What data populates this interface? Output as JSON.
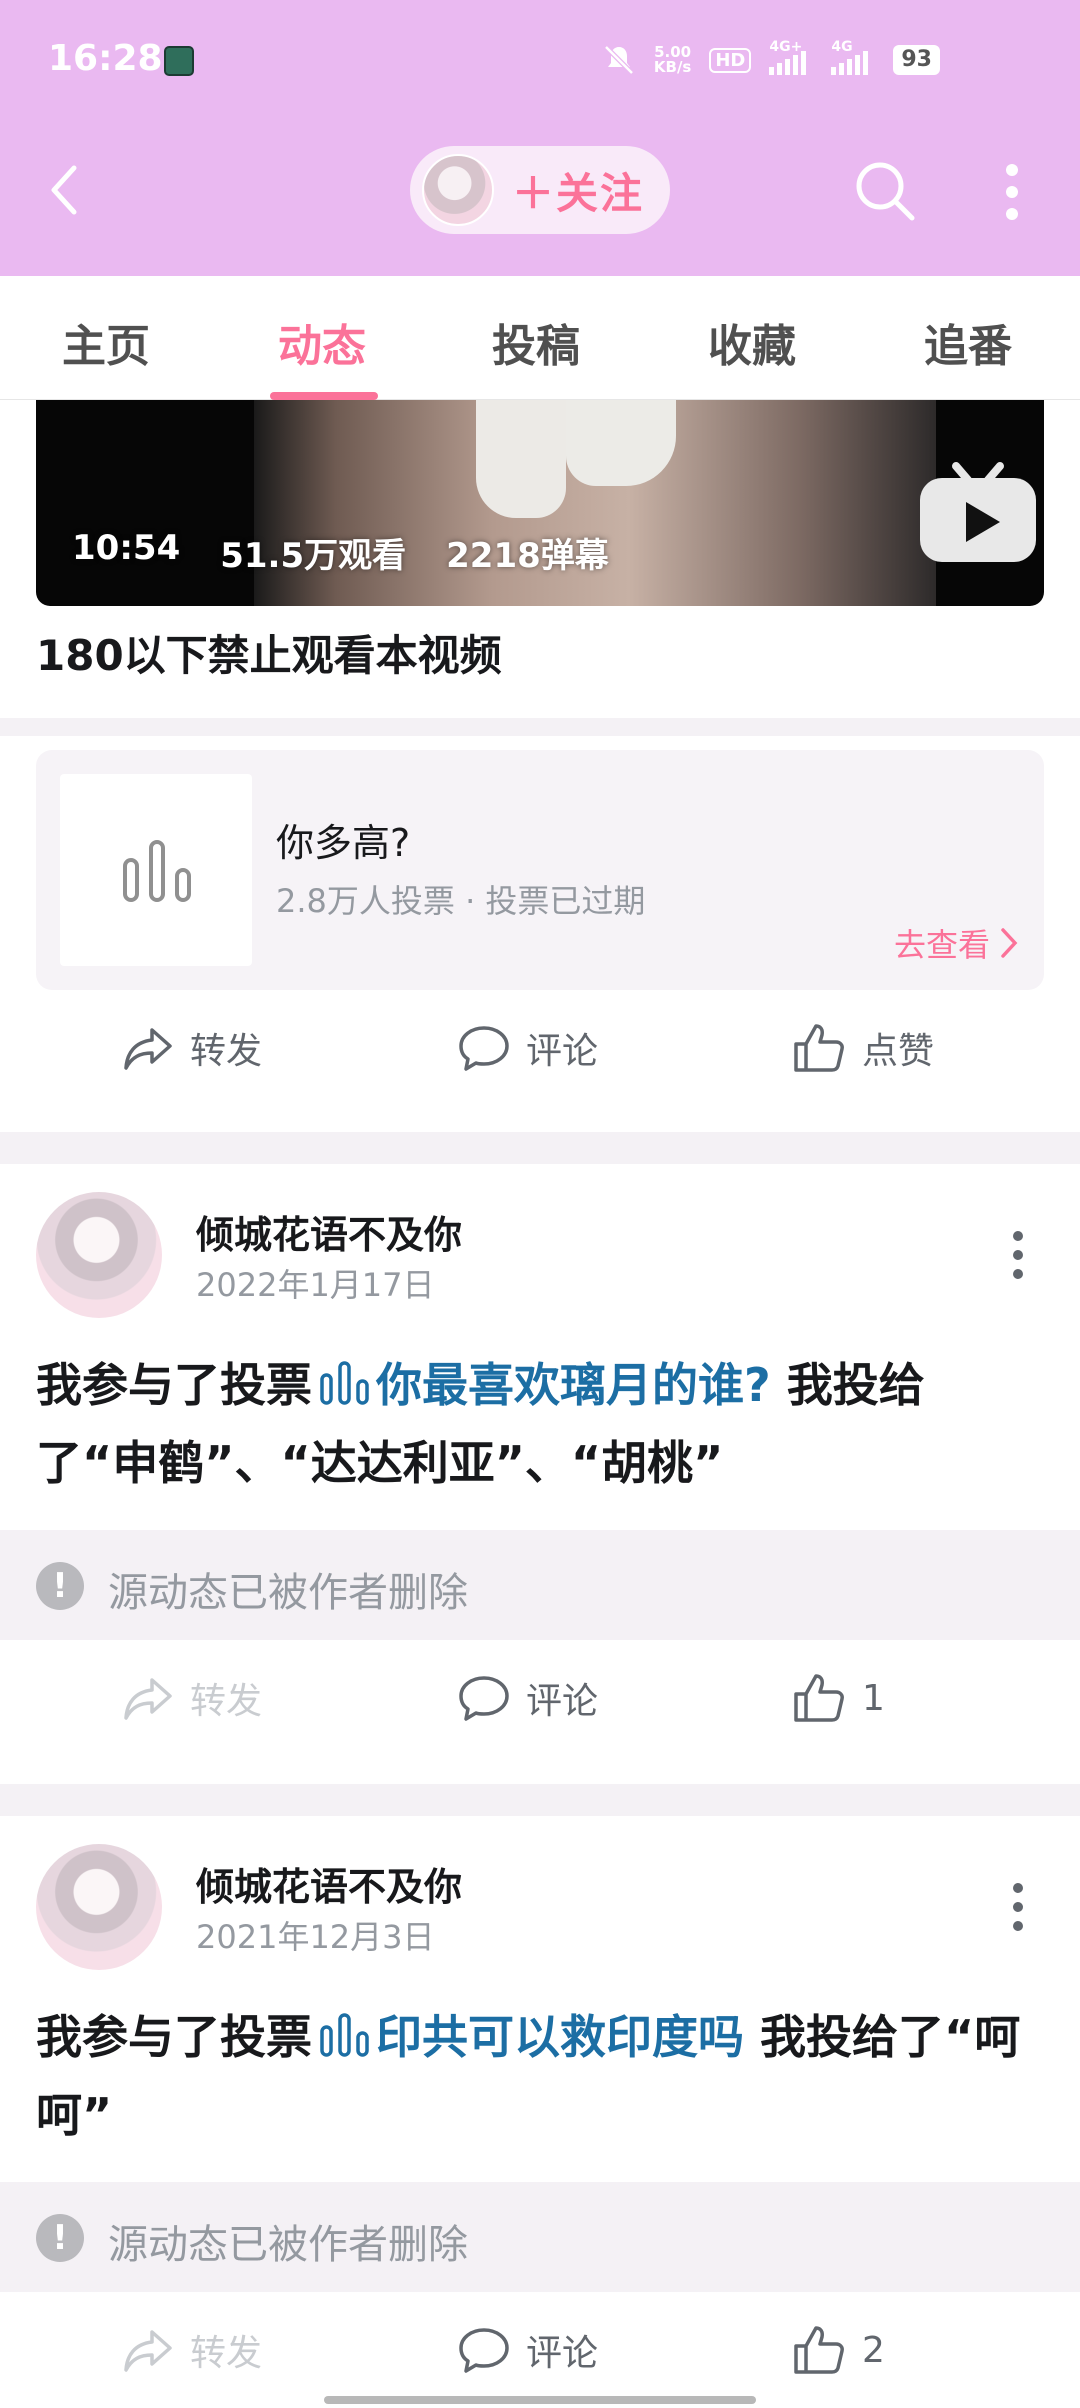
{
  "status_bar": {
    "time": "16:28",
    "speed": "5.00",
    "speed_unit": "KB/s",
    "hd_label": "HD",
    "net1": "4G+",
    "net2": "4G",
    "battery": "93"
  },
  "header": {
    "follow_label": "＋关注",
    "icons": [
      "back-icon",
      "search-icon",
      "more-icon"
    ]
  },
  "tabs": [
    {
      "label": "主页"
    },
    {
      "label": "动态",
      "active": true
    },
    {
      "label": "投稿"
    },
    {
      "label": "收藏"
    },
    {
      "label": "追番"
    }
  ],
  "card1": {
    "video": {
      "duration": "10:54",
      "views": "51.5万观看",
      "danmaku": "2218弹幕",
      "title": "180以下禁止观看本视频"
    },
    "poll": {
      "title": "你多高?",
      "meta": "2.8万人投票 · 投票已过期",
      "link": "去查看"
    },
    "actions": {
      "repost": "转发",
      "comment": "评论",
      "like": "点赞"
    }
  },
  "posts": [
    {
      "author": "倾城花语不及你",
      "date": "2022年1月17日",
      "text_prefix": "我参与了投票",
      "vote_link": "你最喜欢璃月的谁?",
      "text_suffix": " 我投给了“申鹤”、“达达利亚”、“胡桃”",
      "deleted_msg": "源动态已被作者删除",
      "repost": "转发",
      "comment": "评论",
      "likes": "1"
    },
    {
      "author": "倾城花语不及你",
      "date": "2021年12月3日",
      "text_prefix": "我参与了投票",
      "vote_link": "印共可以救印度吗",
      "text_suffix": " 我投给了“呵呵”",
      "deleted_msg": "源动态已被作者删除",
      "repost": "转发",
      "comment": "评论",
      "likes": "2"
    }
  ],
  "colors": {
    "header_bg": "#eab9f1",
    "accent": "#fb7299",
    "link": "#1c6ea4"
  }
}
